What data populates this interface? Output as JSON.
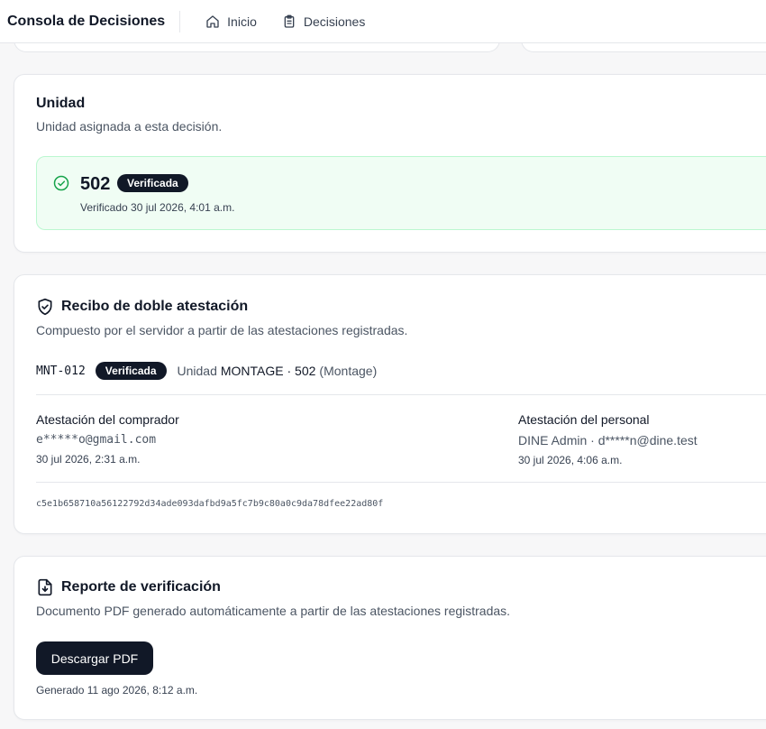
{
  "topbar": {
    "brand": "Consola de Decisiones",
    "nav": [
      {
        "label": "Inicio",
        "icon": "home-icon"
      },
      {
        "label": "Decisiones",
        "icon": "clipboard-icon"
      }
    ]
  },
  "unit_card": {
    "title": "Unidad",
    "description": "Unidad asignada a esta decisión.",
    "unit_number": "502",
    "badge": "Verificada",
    "verified_text": "Verificado 30 jul 2026, 4:01 a.m.",
    "icon": "check-circle-icon"
  },
  "receipt_card": {
    "title": "Recibo de doble atestación",
    "description": "Compuesto por el servidor a partir de las atestaciones registradas.",
    "code": "MNT-012",
    "badge": "Verificada",
    "unit_prefix": "Unidad",
    "unit_name": "MONTAGE · 502",
    "unit_type": "(Montage)",
    "buyer": {
      "label": "Atestación del comprador",
      "email": "e*****o@gmail.com",
      "time": "30 jul 2026, 2:31 a.m."
    },
    "staff": {
      "label": "Atestación del personal",
      "identity": "DINE Admin · d*****n@dine.test",
      "time": "30 jul 2026, 4:06 a.m."
    },
    "hash": "c5e1b658710a56122792d34ade093dafbd9a5fc7b9c80a0c9da78dfee22ad80f",
    "icon": "shield-check-icon"
  },
  "report_card": {
    "title": "Reporte de verificación",
    "description": "Documento PDF generado automáticamente a partir de las atestaciones registradas.",
    "button": "Descargar PDF",
    "generated": "Generado 11 ago 2026, 8:12 a.m.",
    "icon": "file-download-icon"
  },
  "colors": {
    "accent_dark": "#111827",
    "success_bg": "#f0fdf4",
    "success_border": "#bbf7d0",
    "success_icon": "#16a34a"
  }
}
